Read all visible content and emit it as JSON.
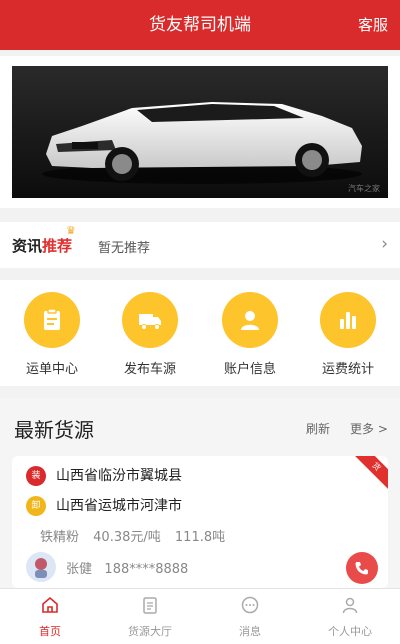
{
  "header": {
    "title": "货友帮司机端",
    "service": "客服"
  },
  "banner": {
    "caption": "汽车之家"
  },
  "news": {
    "logo_main": "资讯",
    "logo_hot": "推荐",
    "text": "暂无推荐"
  },
  "quick": [
    {
      "label": "运单中心",
      "icon": "clipboard-icon"
    },
    {
      "label": "发布车源",
      "icon": "truck-icon"
    },
    {
      "label": "账户信息",
      "icon": "user-icon"
    },
    {
      "label": "运费统计",
      "icon": "bar-chart-icon"
    }
  ],
  "section": {
    "title": "最新货源",
    "refresh": "刷新",
    "more": "更多 >"
  },
  "cargo": {
    "badge": "货",
    "load_tag": "装",
    "load_addr": "山西省临汾市翼城县",
    "unload_tag": "卸",
    "unload_addr": "山西省运城市河津市",
    "goods": "铁精粉",
    "price": "40.38元/吨",
    "weight": "111.8吨",
    "contact": "张健",
    "phone": "188****8888"
  },
  "tabs": [
    {
      "label": "首页",
      "active": true
    },
    {
      "label": "货源大厅",
      "active": false
    },
    {
      "label": "消息",
      "active": false
    },
    {
      "label": "个人中心",
      "active": false
    }
  ],
  "colors": {
    "brand": "#d92b2b",
    "accent": "#fdc42b"
  }
}
